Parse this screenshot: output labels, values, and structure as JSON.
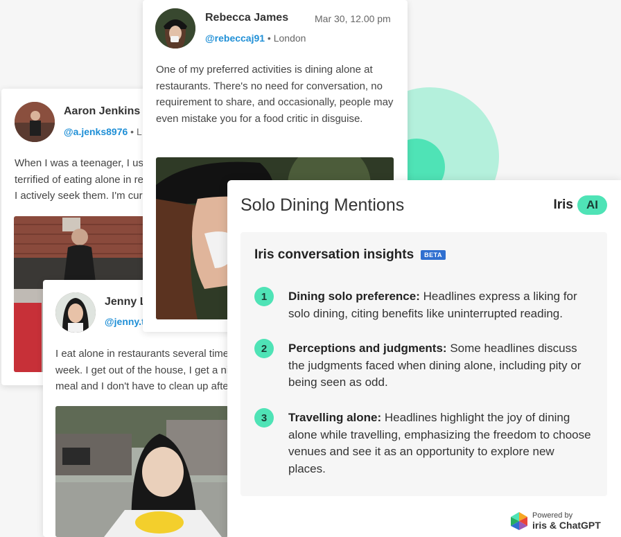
{
  "posts": {
    "aaron": {
      "name": "Aaron Jenkins",
      "handle": "@a.jenks8976",
      "location_sep": " • L",
      "body": "When I was a teenager, I used to be terrified of eating alone in restaurants. Now I actively seek them. I'm currently drinking"
    },
    "jenny": {
      "name": "Jenny L",
      "handle": "@jenny.t",
      "body": "I eat alone in restaurants several times a week. I get out of the house, I get a nice meal and I don't have to clean up after..."
    },
    "rebecca": {
      "name": "Rebecca James",
      "handle": "@rebeccaj91",
      "location_sep": " • London",
      "date": "Mar 30, 12.00 pm",
      "body": "One of my preferred activities is dining alone at restaurants. There's no need for conversation, no requirement to share, and occasionally, people may even mistake you for a food critic in disguise."
    }
  },
  "insights_panel": {
    "title": "Solo Dining Mentions",
    "brand_name": "Iris",
    "brand_badge": "AI",
    "inner_title": "Iris conversation insights",
    "beta": "BETA",
    "items": [
      {
        "number": "1",
        "heading": "Dining solo preference:",
        "text": " Headlines express a liking for solo dining, citing benefits like uninterrupted reading."
      },
      {
        "number": "2",
        "heading": "Perceptions and judgments:",
        "text": " Some headlines discuss the judgments faced when dining alone, including pity or being seen as odd."
      },
      {
        "number": "3",
        "heading": "Travelling alone:",
        "text": " Headlines highlight the joy of dining alone while travelling, emphasizing the freedom to choose venues and see it as an opportunity to explore new places."
      }
    ],
    "powered_small": "Powered by",
    "powered_big": "iris & ChatGPT"
  },
  "colors": {
    "accent_mint": "#4fe3b6",
    "accent_light": "#b4f0dc",
    "link_blue": "#1f8fd6",
    "beta_blue": "#2f6fd0"
  }
}
